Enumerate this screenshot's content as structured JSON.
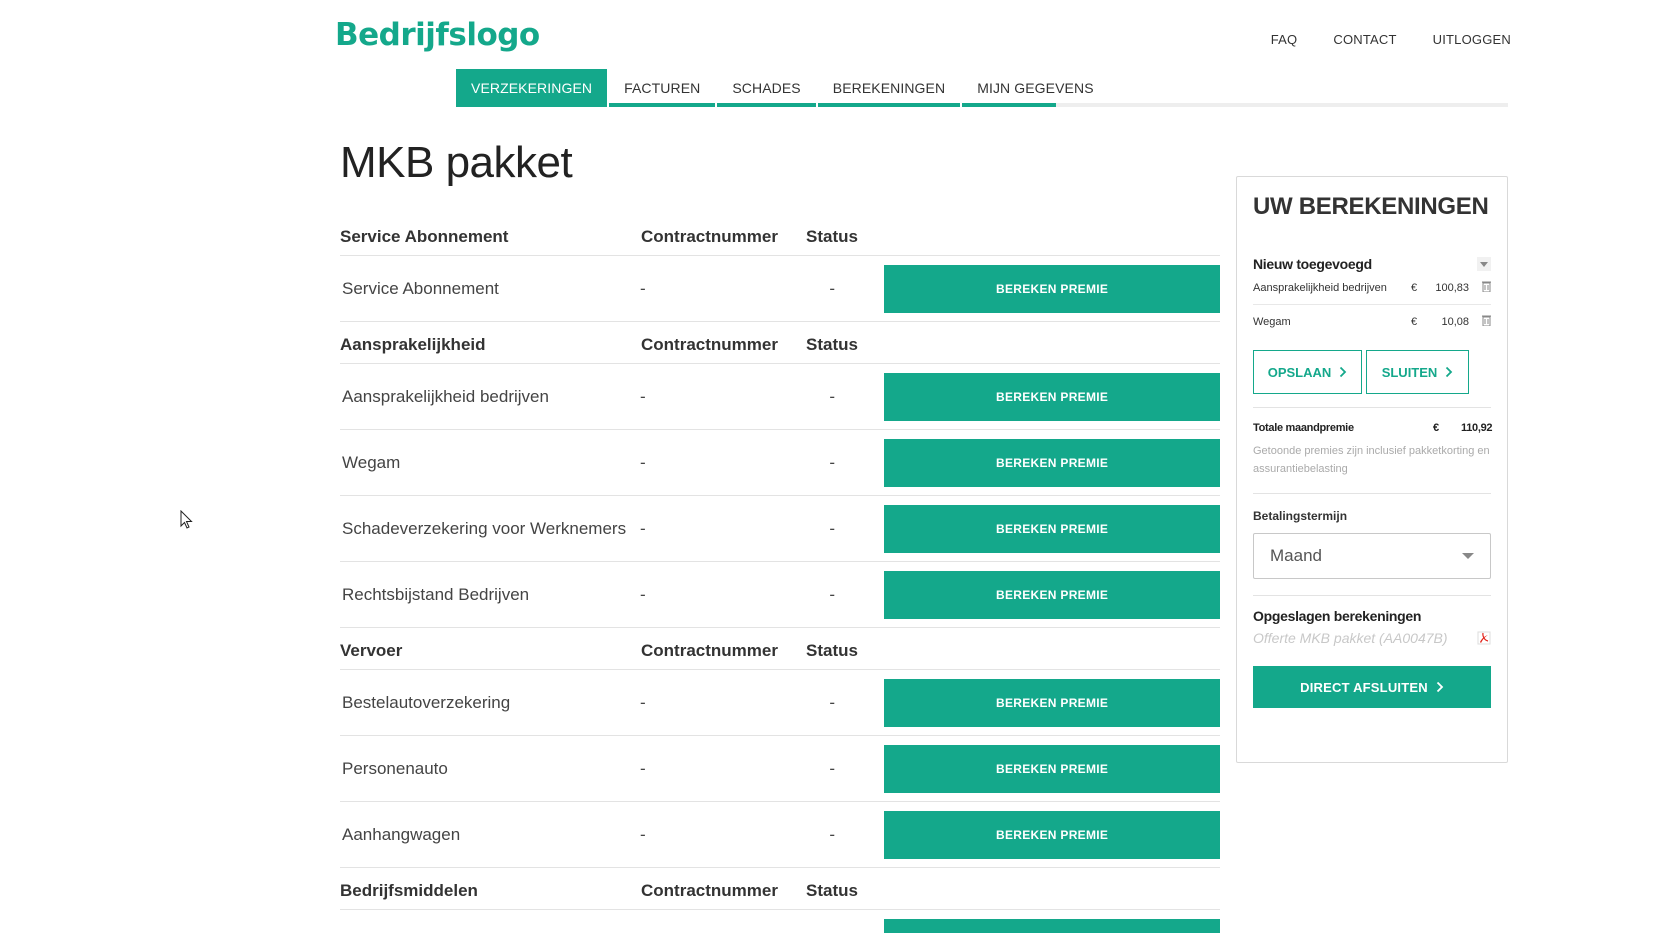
{
  "header": {
    "logo": "Bedrijfslogo",
    "links": [
      "FAQ",
      "CONTACT",
      "UITLOGGEN"
    ]
  },
  "tabs": [
    {
      "label": "VERZEKERINGEN",
      "active": true
    },
    {
      "label": "FACTUREN",
      "active": false
    },
    {
      "label": "SCHADES",
      "active": false
    },
    {
      "label": "BEREKENINGEN",
      "active": false
    },
    {
      "label": "MIJN GEGEVENS",
      "active": false
    }
  ],
  "page": {
    "title": "MKB pakket"
  },
  "groups": [
    {
      "name": "Service Abonnement",
      "col_contract": "Contractnummer",
      "col_status": "Status",
      "rows": [
        {
          "name": "Service Abonnement",
          "contract": "-",
          "status": "-",
          "button": "BEREKEN PREMIE"
        }
      ]
    },
    {
      "name": "Aansprakelijkheid",
      "col_contract": "Contractnummer",
      "col_status": "Status",
      "rows": [
        {
          "name": "Aansprakelijkheid bedrijven",
          "contract": "-",
          "status": "-",
          "button": "BEREKEN PREMIE"
        },
        {
          "name": "Wegam",
          "contract": "-",
          "status": "-",
          "button": "BEREKEN PREMIE"
        },
        {
          "name": "Schadeverzekering voor Werknemers",
          "contract": "-",
          "status": "-",
          "button": "BEREKEN PREMIE"
        },
        {
          "name": "Rechtsbijstand Bedrijven",
          "contract": "-",
          "status": "-",
          "button": "BEREKEN PREMIE"
        }
      ]
    },
    {
      "name": "Vervoer",
      "col_contract": "Contractnummer",
      "col_status": "Status",
      "rows": [
        {
          "name": "Bestelautoverzekering",
          "contract": "-",
          "status": "-",
          "button": "BEREKEN PREMIE"
        },
        {
          "name": "Personenauto",
          "contract": "-",
          "status": "-",
          "button": "BEREKEN PREMIE"
        },
        {
          "name": "Aanhangwagen",
          "contract": "-",
          "status": "-",
          "button": "BEREKEN PREMIE"
        }
      ]
    },
    {
      "name": "Bedrijfsmiddelen",
      "col_contract": "Contractnummer",
      "col_status": "Status",
      "rows": []
    }
  ],
  "panel": {
    "title": "UW BEREKENINGEN",
    "new_label": "Nieuw toegevoegd",
    "items": [
      {
        "name": "Aansprakelijkheid bedrijven",
        "currency": "€",
        "value": "100,83"
      },
      {
        "name": "Wegam",
        "currency": "€",
        "value": "10,08"
      }
    ],
    "save_label": "OPSLAAN",
    "close_label": "SLUITEN",
    "total_label": "Totale maandpremie",
    "total_currency": "€",
    "total_value": "110,92",
    "note": "Getoonde premies zijn inclusief pakketkorting en assurantiebelasting",
    "term_label": "Betalingstermijn",
    "term_value": "Maand",
    "saved_label": "Opgeslagen berekeningen",
    "saved_item": "Offerte MKB pakket (AA0047B)",
    "direct_label": "DIRECT AFSLUITEN"
  },
  "colors": {
    "accent": "#14a88b"
  }
}
